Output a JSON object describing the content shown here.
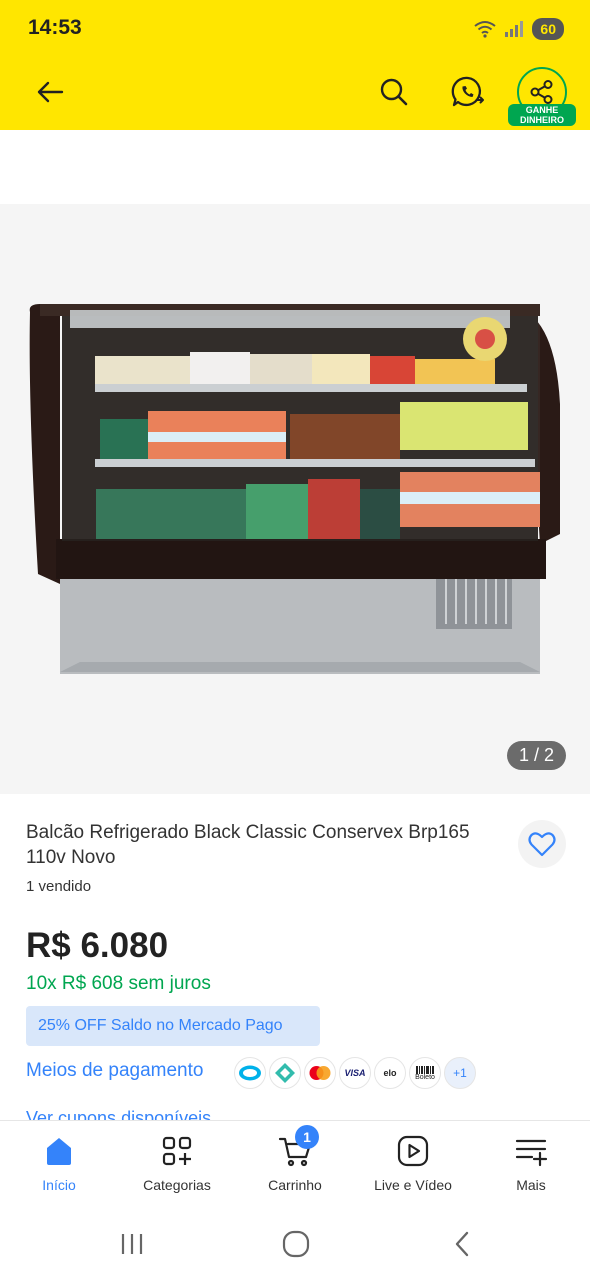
{
  "status_bar": {
    "time": "14:53",
    "battery": "60"
  },
  "header": {
    "share_label": "GANHE DINHEIRO"
  },
  "gallery": {
    "counter": "1 / 2"
  },
  "product": {
    "title": "Balcão Refrigerado Black Classic Conservex Brp165 110v Novo",
    "sold": "1 vendido",
    "price": "R$ 6.080",
    "installments": "10x R$ 608 sem juros",
    "promo": "25% OFF Saldo no Mercado Pago",
    "payment_link": "Meios de pagamento",
    "payment_more": "+1",
    "coupon": "Ver cupons disponíveis"
  },
  "payment_icons": [
    "elo",
    "visa",
    "boleto"
  ],
  "bottom_nav": {
    "items": [
      {
        "label": "Início"
      },
      {
        "label": "Categorias"
      },
      {
        "label": "Carrinho"
      },
      {
        "label": "Live e Vídeo"
      },
      {
        "label": "Mais"
      }
    ],
    "cart_count": "1"
  },
  "colors": {
    "header_bg": "#FFE600",
    "accent_blue": "#3483FA",
    "green": "#00A650"
  }
}
